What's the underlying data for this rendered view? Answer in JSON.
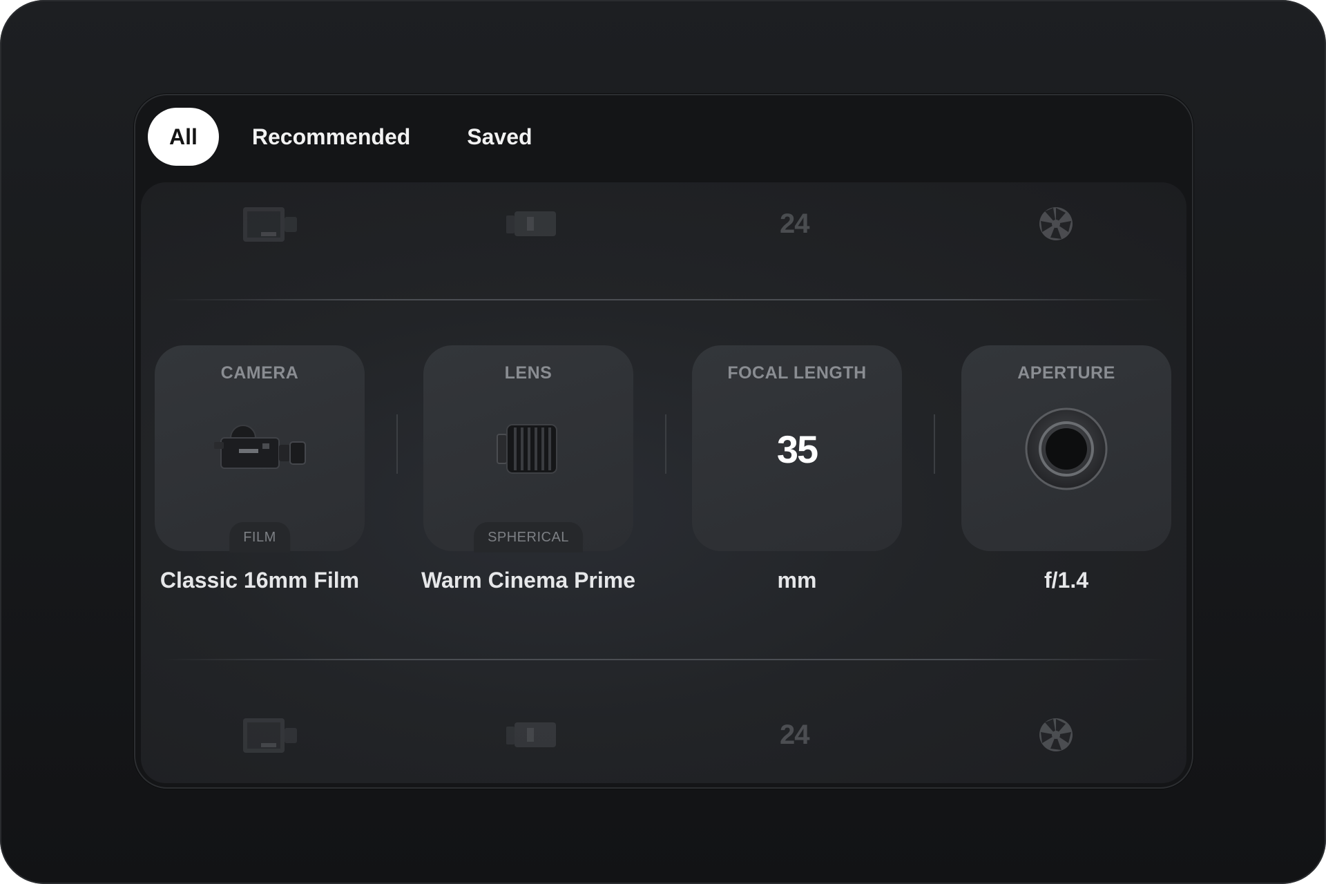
{
  "tabs": [
    {
      "label": "All",
      "active": true
    },
    {
      "label": "Recommended",
      "active": false
    },
    {
      "label": "Saved",
      "active": false
    }
  ],
  "ghost_rows": {
    "focal_value": "24"
  },
  "cards": {
    "camera": {
      "title": "CAMERA",
      "badge": "FILM",
      "caption": "Classic 16mm Film"
    },
    "lens": {
      "title": "LENS",
      "badge": "SPHERICAL",
      "caption": "Warm Cinema Prime"
    },
    "focal": {
      "title": "FOCAL LENGTH",
      "value": "35",
      "caption": "mm"
    },
    "aperture": {
      "title": "APERTURE",
      "caption": "f/1.4"
    }
  },
  "icons": {
    "camera": "film-camera-icon",
    "lens": "cine-lens-icon",
    "aperture": "aperture-ring-icon",
    "ghost_aperture": "aperture-blades-icon"
  },
  "colors": {
    "background": "#1d1f22",
    "panel": "#141517",
    "card": "#303236",
    "active_tab": "#ffffff",
    "text": "#e6e7e9",
    "muted": "#8a8d92"
  }
}
